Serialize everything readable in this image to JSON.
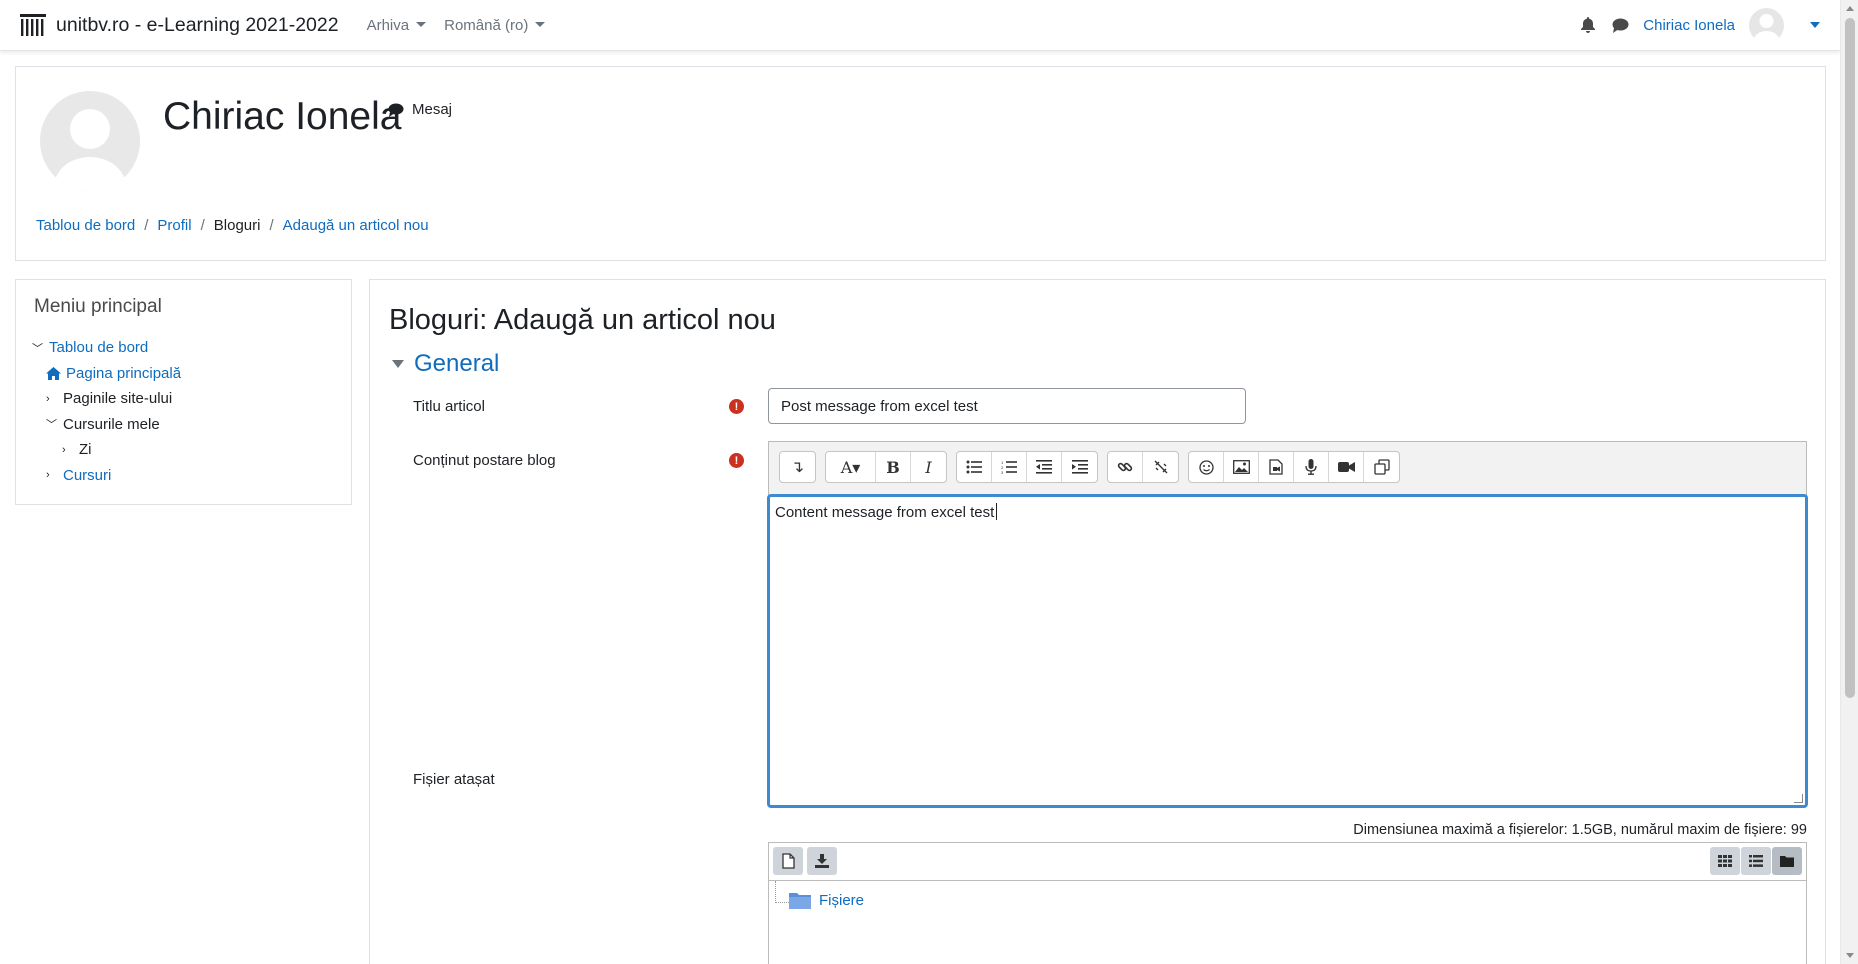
{
  "navbar": {
    "site_name": "unitbv.ro - e-Learning 2021-2022",
    "menu": [
      "Arhiva",
      "Română (ro)"
    ],
    "user_name": "Chiriac Ionela"
  },
  "header": {
    "user_title": "Chiriac Ionela",
    "message_label": "Mesaj",
    "breadcrumb": [
      "Tablou de bord",
      "Profil",
      "Bloguri",
      "Adaugă un articol nou"
    ]
  },
  "sidebar": {
    "title": "Meniu principal",
    "items": [
      {
        "label": "Tablou de bord",
        "chevron": "down"
      },
      {
        "label": "Pagina principală",
        "chevron": "home"
      },
      {
        "label": "Paginile site-ului",
        "chevron": "right"
      },
      {
        "label": "Cursurile mele",
        "chevron": "down"
      },
      {
        "label": "Zi",
        "chevron": "right"
      },
      {
        "label": "Cursuri",
        "chevron": "right"
      }
    ]
  },
  "main": {
    "page_title": "Bloguri: Adaugă un articol nou",
    "section_label": "General",
    "fields": {
      "title_label": "Titlu articol",
      "title_value": "Post message from excel test",
      "content_label": "Conținut postare blog",
      "content_value": "Content message from excel test",
      "attachment_label": "Fișier atașat",
      "file_limits": "Dimensiunea maximă a fișierelor: 1.5GB, numărul maxim de fișiere: 99",
      "folder_name": "Fișiere"
    }
  },
  "colors": {
    "link": "#0f6cbf",
    "required": "#ca3120",
    "editor_focus": "#3d8ad0"
  }
}
